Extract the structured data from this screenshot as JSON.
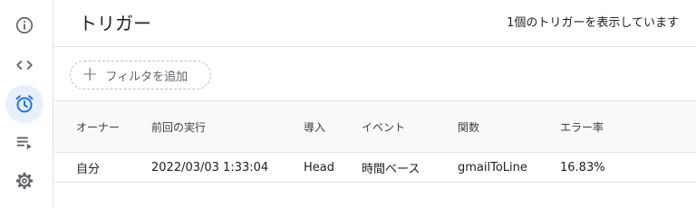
{
  "sidebar": {
    "items": [
      {
        "icon": "info-icon"
      },
      {
        "icon": "code-icon"
      },
      {
        "icon": "alarm-clock-icon",
        "active": true
      },
      {
        "icon": "executions-list-icon"
      },
      {
        "icon": "gear-icon"
      }
    ],
    "active_color": "#1a73e8"
  },
  "header": {
    "title": "トリガー",
    "count_text": "1個のトリガーを表示しています"
  },
  "filter": {
    "plus": "+",
    "label": "フィルタを追加"
  },
  "table": {
    "columns": [
      "オーナー",
      "前回の実行",
      "導入",
      "イベント",
      "関数",
      "エラー率"
    ],
    "rows": [
      [
        "自分",
        "2022/03/03 1:33:04",
        "Head",
        "時間ベース",
        "gmailToLine",
        "16.83%"
      ]
    ]
  }
}
